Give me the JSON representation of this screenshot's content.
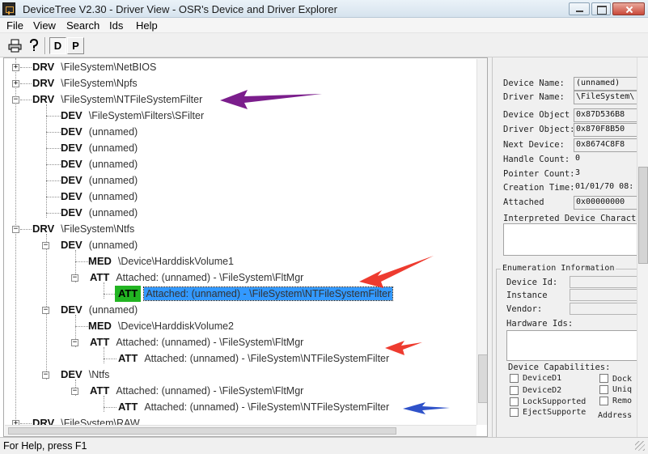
{
  "window": {
    "title": "DeviceTree V2.30 - Driver View - OSR's Device and Driver Explorer"
  },
  "menu": [
    "File",
    "View",
    "Search",
    "Ids",
    "Help"
  ],
  "toolbar": {
    "print_icon": "printer-icon",
    "help_icon": "help-icon",
    "d_label": "D",
    "p_label": "P"
  },
  "tree": {
    "rows": [
      {
        "tag": "DRV",
        "label": "\\FileSystem\\NetBIOS"
      },
      {
        "tag": "DRV",
        "label": "\\FileSystem\\Npfs"
      },
      {
        "tag": "DRV",
        "label": "\\FileSystem\\NTFileSystemFilter"
      },
      {
        "tag": "DEV",
        "label": "\\FileSystem\\Filters\\SFilter"
      },
      {
        "tag": "DEV",
        "label": "(unnamed)"
      },
      {
        "tag": "DEV",
        "label": "(unnamed)"
      },
      {
        "tag": "DEV",
        "label": "(unnamed)"
      },
      {
        "tag": "DEV",
        "label": "(unnamed)"
      },
      {
        "tag": "DEV",
        "label": "(unnamed)"
      },
      {
        "tag": "DEV",
        "label": "(unnamed)"
      },
      {
        "tag": "DRV",
        "label": "\\FileSystem\\Ntfs"
      },
      {
        "tag": "DEV",
        "label": "(unnamed)"
      },
      {
        "tag": "MED",
        "label": "\\Device\\HarddiskVolume1"
      },
      {
        "tag": "ATT",
        "label": "Attached: (unnamed) - \\FileSystem\\FltMgr"
      },
      {
        "tag": "ATT",
        "label": "Attached: (unnamed) - \\FileSystem\\NTFileSystemFilter"
      },
      {
        "tag": "DEV",
        "label": "(unnamed)"
      },
      {
        "tag": "MED",
        "label": "\\Device\\HarddiskVolume2"
      },
      {
        "tag": "ATT",
        "label": "Attached: (unnamed) - \\FileSystem\\FltMgr"
      },
      {
        "tag": "ATT",
        "label": "Attached: (unnamed) - \\FileSystem\\NTFileSystemFilter"
      },
      {
        "tag": "DEV",
        "label": "\\Ntfs"
      },
      {
        "tag": "ATT",
        "label": "Attached: (unnamed) - \\FileSystem\\FltMgr"
      },
      {
        "tag": "ATT",
        "label": "Attached: (unnamed) - \\FileSystem\\NTFileSystemFilter"
      },
      {
        "tag": "DRV",
        "label": "\\FileSystem\\RAW"
      }
    ],
    "expander_plus": "+",
    "expander_minus": "−"
  },
  "details": {
    "device_name_label": "Device Name:",
    "device_name": "(unnamed)",
    "driver_name_label": "Driver Name:",
    "driver_name": "\\FileSystem\\",
    "device_object_label": "Device Object",
    "device_object": "0x87D536B8",
    "driver_object_label": "Driver Object:",
    "driver_object": "0x870F8B50",
    "next_device_label": "Next Device:",
    "next_device": "0x8674C8F8",
    "handle_count_label": "Handle Count:",
    "handle_count": "0",
    "pointer_count_label": "Pointer Count:",
    "pointer_count": "3",
    "creation_time_label": "Creation Time:",
    "creation_time": "01/01/70 08:",
    "attached_label": "Attached",
    "attached": "0x00000000",
    "interpreted_label": "Interpreted Device Characte",
    "enum_title": "Enumeration Information",
    "device_id_label": "Device Id:",
    "instance_label": "Instance",
    "vendor_label": "Vendor:",
    "hardware_ids_label": "Hardware Ids:",
    "capabilities_title": "Device Capabilities:",
    "cap_d1": "DeviceD1",
    "cap_d2": "DeviceD2",
    "cap_lock": "LockSupported",
    "cap_eject": "EjectSupporte",
    "cap_dock": "Dock",
    "cap_uniq": "Uniq",
    "cap_remo": "Remo",
    "address_label": "Address"
  },
  "status": {
    "text": "For Help, press F1"
  },
  "annotation_colors": {
    "purple": "#7b1e8c",
    "red": "#ee3b2f",
    "blue": "#2f52c9"
  }
}
